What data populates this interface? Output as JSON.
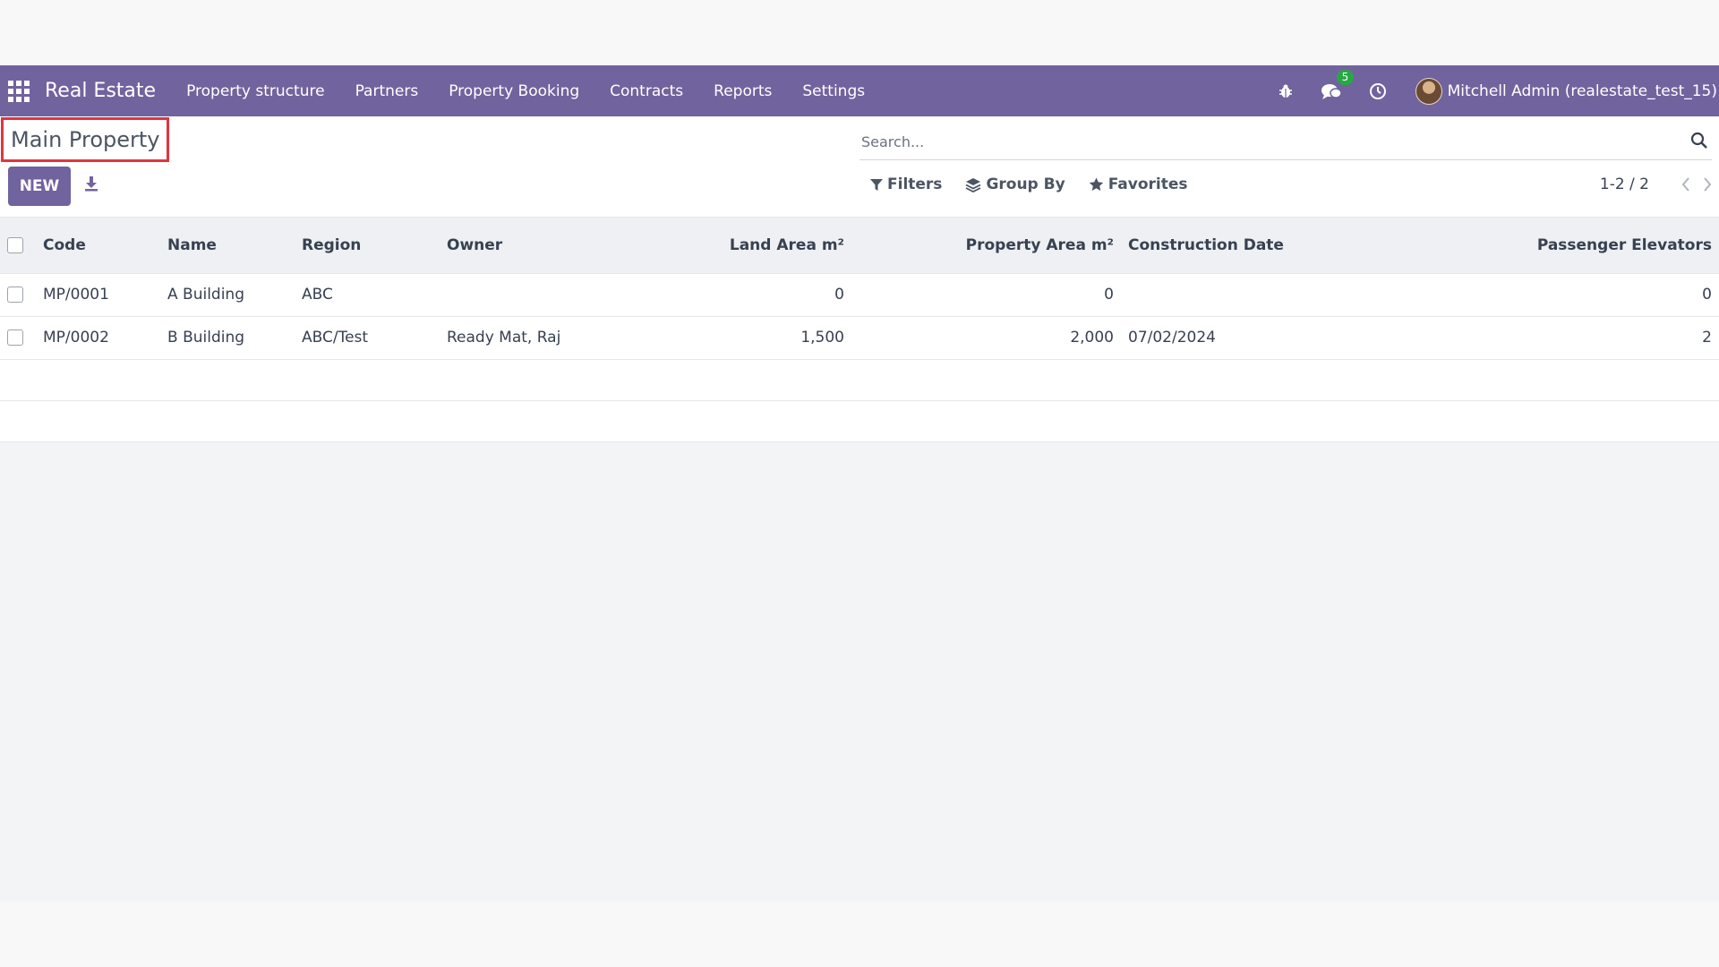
{
  "navbar": {
    "brand": "Real Estate",
    "menu": [
      "Property structure",
      "Partners",
      "Property Booking",
      "Contracts",
      "Reports",
      "Settings"
    ],
    "icons": [
      "debug-icon",
      "chat-icon",
      "clock-icon"
    ],
    "chat_badge": "5",
    "user": "Mitchell Admin (realestate_test_15)",
    "background_color": "#71639e"
  },
  "control": {
    "title": "Main Property",
    "new_label": "NEW",
    "search_placeholder": "Search...",
    "filters_label": "Filters",
    "group_by_label": "Group By",
    "favorites_label": "Favorites",
    "pager_value": "1-2 / 2"
  },
  "table": {
    "columns": [
      "Code",
      "Name",
      "Region",
      "Owner",
      "Land Area m²",
      "Property Area m²",
      "Construction Date",
      "Passenger Elevators"
    ],
    "rows": [
      {
        "code": "MP/0001",
        "name": "A Building",
        "region": "ABC",
        "owner": "",
        "land_area": "0",
        "property_area": "0",
        "construction_date": "",
        "elevators": "0"
      },
      {
        "code": "MP/0002",
        "name": "B Building",
        "region": "ABC/Test",
        "owner": "Ready Mat, Raj",
        "land_area": "1,500",
        "property_area": "2,000",
        "construction_date": "07/02/2024",
        "elevators": "2"
      }
    ]
  }
}
